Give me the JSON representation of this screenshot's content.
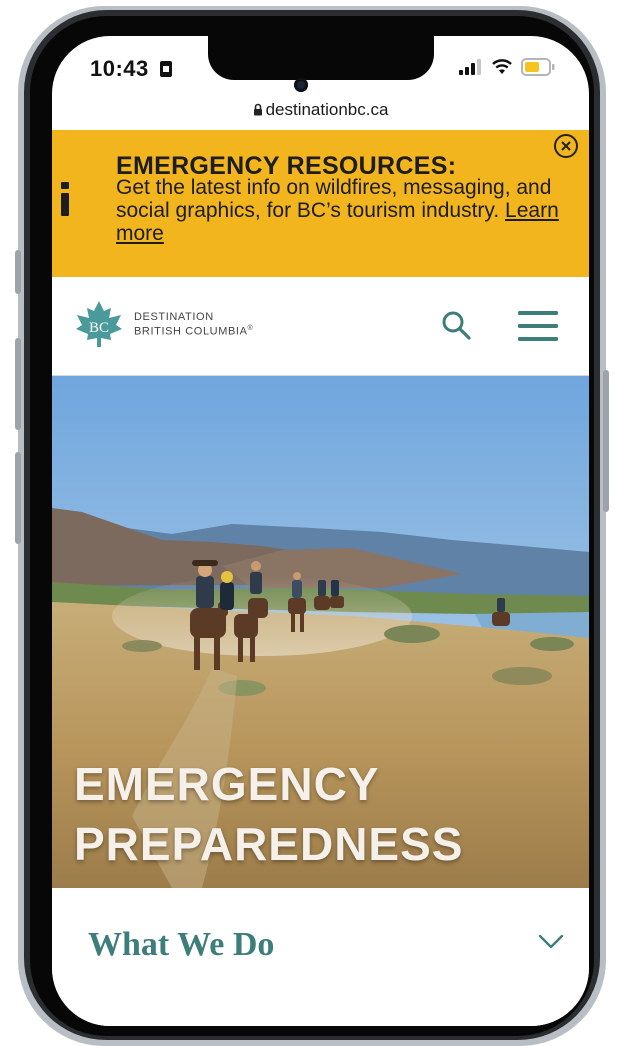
{
  "status_bar": {
    "time": "10:43"
  },
  "browser": {
    "url": "destinationbc.ca"
  },
  "banner": {
    "title": "EMERGENCY RESOURCES:",
    "body": "Get the latest info on wildfires, messaging, and social graphics, for BC’s tourism industry.",
    "link_label": "Learn more"
  },
  "header": {
    "logo_line1": "DESTINATION",
    "logo_line2": "BRITISH COLUMBIA",
    "logo_trademark": "®",
    "logo_mark": "BC"
  },
  "hero": {
    "title_line1": "EMERGENCY",
    "title_line2": "PREPAREDNESS"
  },
  "section": {
    "label": "What We Do"
  },
  "colors": {
    "banner": "#f2b51d",
    "brand_teal": "#3d7d7a",
    "logo_teal": "#4a9a9b"
  },
  "icons": [
    "lock-icon",
    "info-icon",
    "close-icon",
    "bc-leaf-logo",
    "search-icon",
    "menu-icon",
    "chevron-down-icon",
    "signal-icon",
    "wifi-icon",
    "battery-icon",
    "sim-card-icon"
  ]
}
